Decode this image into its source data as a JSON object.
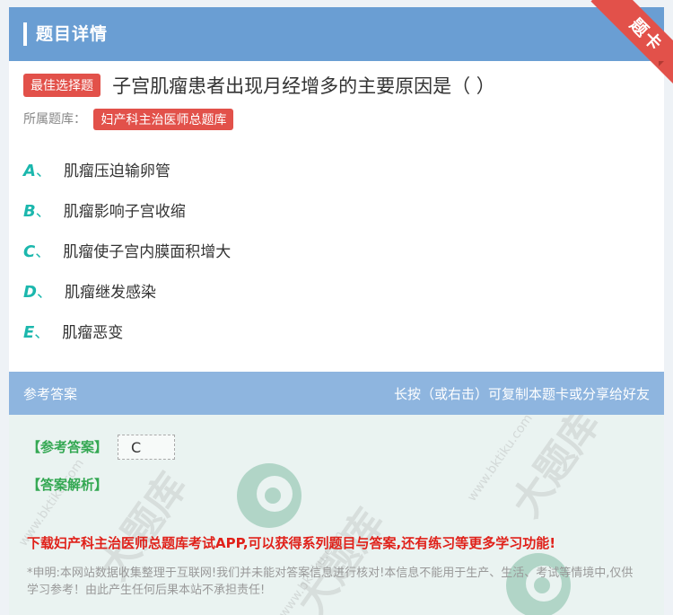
{
  "header": {
    "title": "题目详情"
  },
  "ribbon": {
    "label": "题卡"
  },
  "question": {
    "type_badge": "最佳选择题",
    "text": "子宫肌瘤患者出现月经增多的主要原因是（ ）",
    "bank_label": "所属题库：",
    "bank_name": "妇产科主治医师总题库"
  },
  "options": [
    {
      "letter": "A",
      "sep": "、",
      "text": "肌瘤压迫输卵管"
    },
    {
      "letter": "B",
      "sep": "、",
      "text": "肌瘤影响子宫收缩"
    },
    {
      "letter": "C",
      "sep": "、",
      "text": "肌瘤使子宫内膜面积增大"
    },
    {
      "letter": "D",
      "sep": "、",
      "text": "肌瘤继发感染"
    },
    {
      "letter": "E",
      "sep": "、",
      "text": "肌瘤恶变"
    }
  ],
  "answer_section": {
    "title": "参考答案",
    "hint": "长按（或右击）可复制本题卡或分享给好友",
    "answer_label": "【参考答案】",
    "answer_value": "C",
    "analysis_label": "【答案解析】",
    "promo": "下载妇产科主治医师总题库考试APP,可以获得系列题目与答案,还有练习等更多学习功能!",
    "notice": "*申明:本网站数据收集整理于互联网!我们并未能对答案信息进行核对!本信息不能用于生产、生活、考试等情境中,仅供学习参考！由此产生任何后果本站不承担责任!"
  },
  "colors": {
    "header": "#6a9ed3",
    "accent_red": "#e2514a",
    "option_letter": "#1bb7ad",
    "answer_green": "#34a853"
  }
}
